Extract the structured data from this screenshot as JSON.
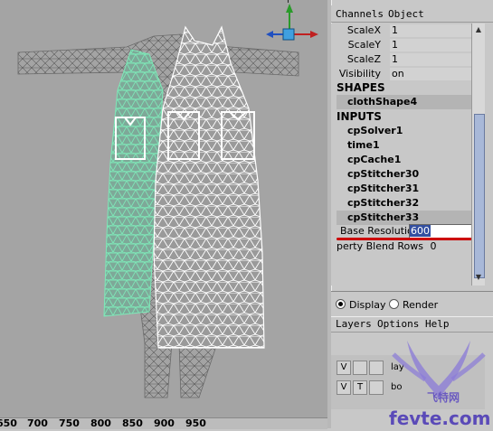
{
  "channel_box": {
    "menu": [
      "Channels",
      "Object"
    ],
    "attributes": [
      {
        "label": "ScaleX",
        "value": "1"
      },
      {
        "label": "ScaleY",
        "value": "1"
      },
      {
        "label": "ScaleZ",
        "value": "1"
      },
      {
        "label": "Visibility",
        "value": "on"
      }
    ],
    "shapes_header": "SHAPES",
    "shape_node": "clothShape4",
    "inputs_header": "INPUTS",
    "input_nodes": [
      "cpSolver1",
      "time1",
      "cpCache1",
      "cpStitcher30",
      "cpStitcher31",
      "cpStitcher32",
      "cpStitcher33"
    ],
    "base_resolution_label": "Base Resolution",
    "base_resolution_value": "600",
    "blend_rows_label": "perty Blend Rows",
    "blend_rows_value": "0"
  },
  "layer_editor": {
    "radio_display": "Display",
    "radio_render": "Render",
    "menu": [
      "Layers",
      "Options",
      "Help"
    ],
    "layers": [
      {
        "v": "V",
        "t": "",
        "name": "lay"
      },
      {
        "v": "V",
        "t": "T",
        "name": "bo"
      }
    ]
  },
  "timeline": {
    "ticks": [
      "650",
      "700",
      "750",
      "800",
      "850",
      "900",
      "950"
    ]
  },
  "watermark": {
    "text": "fevte.com",
    "subtext": "飞特网"
  },
  "colors": {
    "viewport_bg": "#a4a4a4",
    "panel_bg": "#c8c8c8",
    "cloth_green": "#7ee8b8",
    "cloth_white": "#ffffff",
    "highlight_red": "#cc0000",
    "selection_blue": "#334fa0"
  }
}
